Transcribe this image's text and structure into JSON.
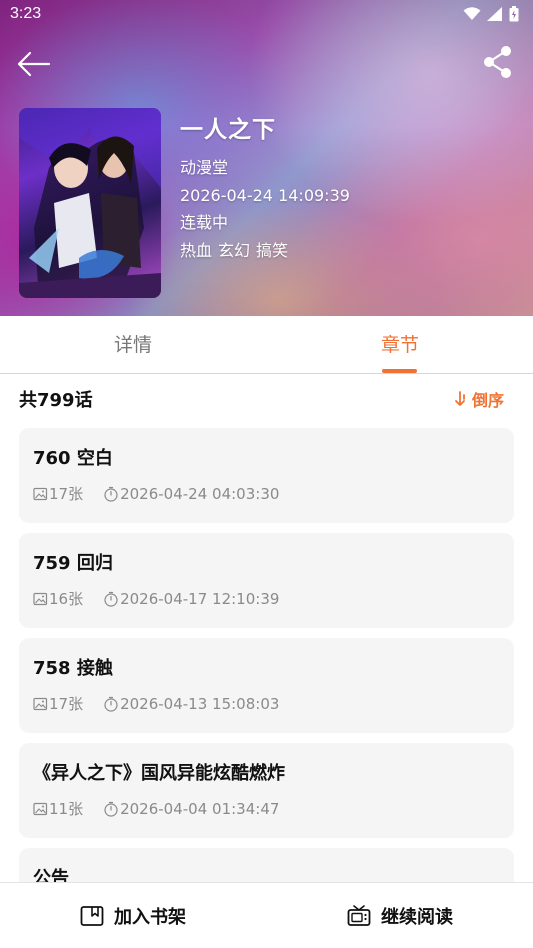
{
  "status_bar": {
    "time": "3:23"
  },
  "comic": {
    "title": "一人之下",
    "source": "动漫堂",
    "updated": "2026-04-24 14:09:39",
    "status": "连载中",
    "tags": [
      "热血",
      "玄幻",
      "搞笑"
    ]
  },
  "tabs": {
    "details": "详情",
    "chapters": "章节"
  },
  "list": {
    "count": "共799话",
    "sort_label": "倒序",
    "chapters": [
      {
        "title": "760 空白",
        "pages": "17张",
        "time": "2026-04-24 04:03:30"
      },
      {
        "title": "759 回归",
        "pages": "16张",
        "time": "2026-04-17 12:10:39"
      },
      {
        "title": "758 接触",
        "pages": "17张",
        "time": "2026-04-13 15:08:03"
      },
      {
        "title": "《异人之下》国风异能炫酷燃炸",
        "pages": "11张",
        "time": "2026-04-04 01:34:47"
      },
      {
        "title": "公告",
        "pages": "",
        "time": ""
      }
    ]
  },
  "bottom_bar": {
    "add_shelf": "加入书架",
    "continue_read": "继续阅读"
  },
  "colors": {
    "accent": "#f07233",
    "card_bg": "#f5f5f5"
  },
  "icons": [
    "back-arrow-icon",
    "share-icon",
    "wifi-icon",
    "signal-icon",
    "battery-icon",
    "sort-icon",
    "image-icon",
    "clock-icon",
    "bookshelf-icon",
    "tv-icon"
  ]
}
